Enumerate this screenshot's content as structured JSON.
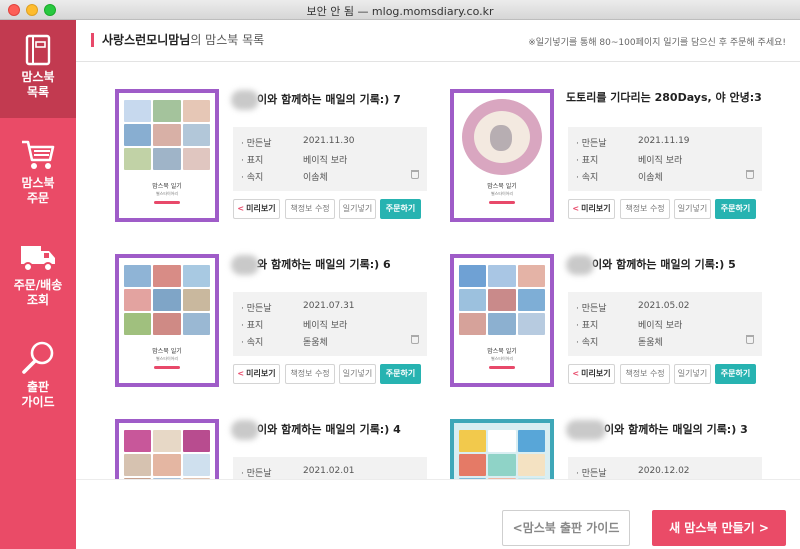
{
  "window": {
    "title": "보안 안 됨 — mlog.momsdiary.co.kr"
  },
  "sidebar": {
    "items": [
      {
        "label1": "맘스북",
        "label2": "목록",
        "icon": "book-icon"
      },
      {
        "label1": "맘스북",
        "label2": "주문",
        "icon": "cart-icon"
      },
      {
        "label1": "주문/배송",
        "label2": "조회",
        "icon": "truck-icon"
      },
      {
        "label1": "출판",
        "label2": "가이드",
        "icon": "magnifier-icon"
      }
    ]
  },
  "header": {
    "owner": "사랑스런모니맘님",
    "suffix": "의 맘스북 목록",
    "note": "※일기넣기를 통해 80~100페이지 일기를 담으신 후 주문해 주세요!"
  },
  "labels": {
    "made": "· 만든날",
    "cover": "· 표지",
    "inner": "· 속지",
    "preview": "미리보기",
    "edit": "책정보 수정",
    "add_diary": "일기넣기",
    "order": "주문하기",
    "cover_title": "맘스북 일기",
    "cover_sub": "별스타이어리"
  },
  "books": [
    {
      "title": "이와 함께하는 매일의 기록:) 7",
      "date": "2021.11.30",
      "cover": "베이직 보라",
      "font": "이솜체"
    },
    {
      "title": "도토리를 기다리는 280Days, 야 안녕:3",
      "date": "2021.11.19",
      "cover": "베이직 보라",
      "font": "이솜체"
    },
    {
      "title": "와 함께하는 매일의 기록:) 6",
      "date": "2021.07.31",
      "cover": "베이직 보라",
      "font": "돋움체"
    },
    {
      "title": "이와 함께하는 매일의 기록:) 5",
      "date": "2021.05.02",
      "cover": "베이직 보라",
      "font": "돋움체"
    },
    {
      "title": "이와 함께하는 매일의 기록:) 4",
      "date": "2021.02.01",
      "cover": "",
      "font": ""
    },
    {
      "title": "이와 함께하는 매일의 기록:) 3",
      "date": "2020.12.02",
      "cover": "",
      "font": ""
    }
  ],
  "footer": {
    "guide_label": "맘스북 출판 가이드",
    "new_label": "새 맘스북 만들기"
  },
  "colors": {
    "accent": "#ea4b67",
    "order": "#27b3b1",
    "cover": "#9f5cc8"
  }
}
